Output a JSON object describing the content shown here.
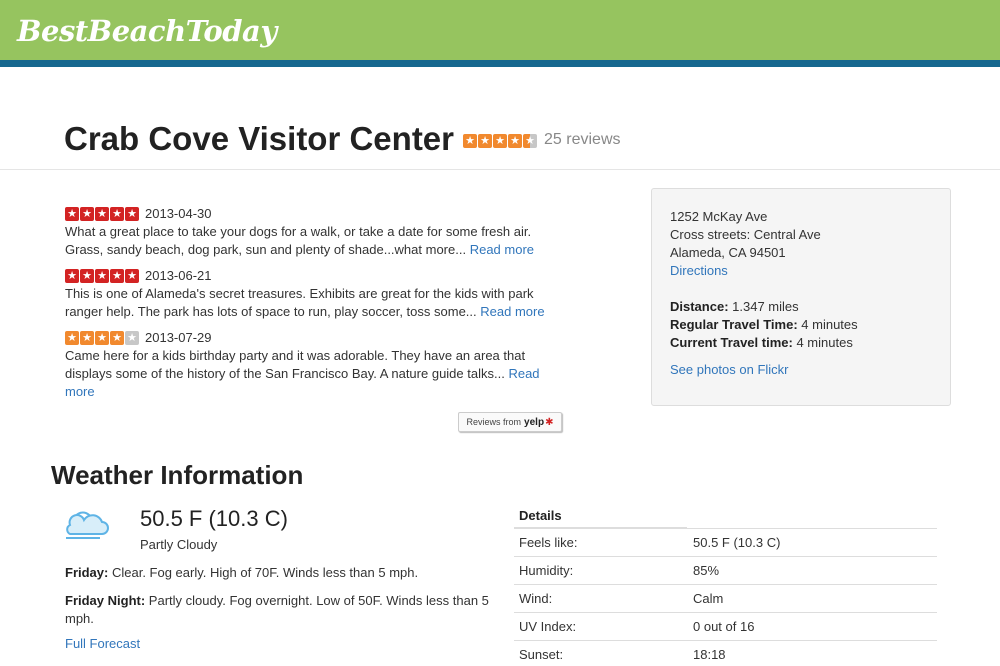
{
  "site": {
    "logo": "BestBeachToday"
  },
  "place": {
    "name": "Crab Cove Visitor Center",
    "rating": 4.5,
    "review_count": "25 reviews"
  },
  "reviews": [
    {
      "rating": 5,
      "date": "2013-04-30",
      "text": "What a great place to take your dogs for a walk, or take a date for some fresh air. Grass, sandy beach, dog park, sun and plenty of shade...what more...",
      "read_more": "Read more"
    },
    {
      "rating": 5,
      "date": "2013-06-21",
      "text": "This is one of Alameda's secret treasures. Exhibits are great for the kids with park ranger help. The park has lots of space to run, play soccer, toss some...",
      "read_more": "Read more"
    },
    {
      "rating": 4,
      "date": "2013-07-29",
      "text": "Came here for a kids birthday party and it was adorable. They have an area that displays some of the history of the San Francisco Bay. A nature guide talks...",
      "read_more": "Read more"
    }
  ],
  "yelp_badge": {
    "prefix": "Reviews from",
    "brand": "yelp"
  },
  "location": {
    "address": "1252 McKay Ave",
    "cross_streets": "Cross streets: Central Ave",
    "city": "Alameda, CA 94501",
    "directions_label": "Directions",
    "distance_label": "Distance:",
    "distance_value": "1.347 miles",
    "regular_label": "Regular Travel Time:",
    "regular_value": "4 minutes",
    "current_label": "Current Travel time:",
    "current_value": "4 minutes",
    "flickr_label": "See photos on Flickr"
  },
  "weather": {
    "title": "Weather Information",
    "icon": "partly-cloudy-icon",
    "temperature": "50.5 F (10.3 C)",
    "condition": "Partly Cloudy",
    "forecast": [
      {
        "label": "Friday:",
        "text": "Clear. Fog early. High of 70F. Winds less than 5 mph."
      },
      {
        "label": "Friday Night:",
        "text": "Partly cloudy. Fog overnight. Low of 50F. Winds less than 5 mph."
      }
    ],
    "full_forecast_label": "Full Forecast",
    "details_header": "Details",
    "details": [
      {
        "label": "Feels like:",
        "value": "50.5 F (10.3 C)"
      },
      {
        "label": "Humidity:",
        "value": "85%"
      },
      {
        "label": "Wind:",
        "value": "Calm"
      },
      {
        "label": "UV Index:",
        "value": "0 out of 16"
      },
      {
        "label": "Sunset:",
        "value": "18:18"
      }
    ]
  },
  "colors": {
    "header_green": "#96c45f",
    "header_stripe": "#16688f",
    "link_blue": "#3176bb",
    "star_red": "#d32323",
    "star_orange": "#f1892e"
  }
}
